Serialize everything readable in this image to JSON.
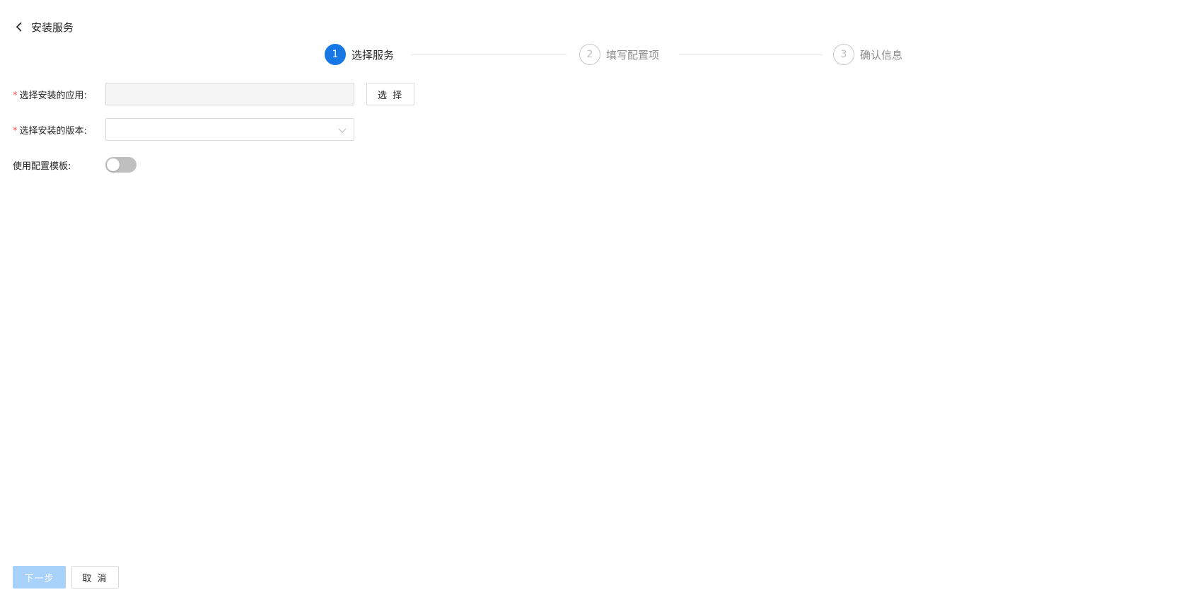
{
  "header": {
    "title": "安装服务",
    "back_icon": "chevron-left-icon"
  },
  "steps": [
    {
      "number": "1",
      "label": "选择服务",
      "status": "active"
    },
    {
      "number": "2",
      "label": "填写配置项",
      "status": "wait"
    },
    {
      "number": "3",
      "label": "确认信息",
      "status": "wait"
    }
  ],
  "form": {
    "app": {
      "required_mark": "*",
      "label": "选择安装的应用:",
      "value": "",
      "select_button": "选 择"
    },
    "version": {
      "required_mark": "*",
      "label": "选择安装的版本:",
      "value": "",
      "icon": "chevron-down-icon"
    },
    "template": {
      "label": "使用配置模板:",
      "enabled": false
    }
  },
  "footer": {
    "next_label": "下一步",
    "cancel_label": "取 消"
  },
  "colors": {
    "primary": "#1677e5",
    "primary_disabled": "#a9d2fb",
    "required": "#ff4d4f",
    "switch_off": "#bfbfbf"
  }
}
